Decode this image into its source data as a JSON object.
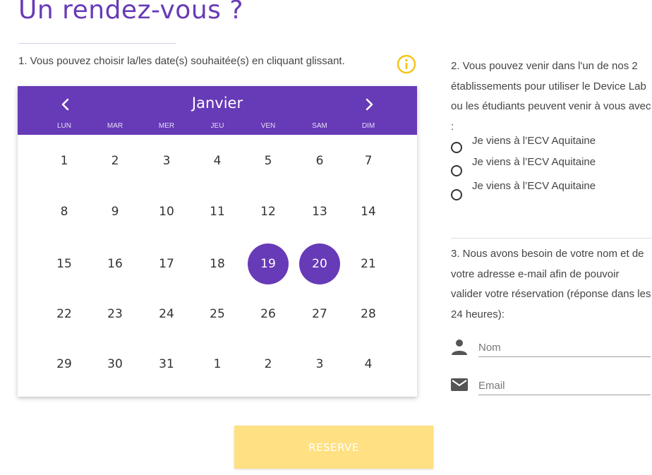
{
  "header": {
    "title": "Un rendez-vous ?",
    "instruction_1": "1. Vous pouvez choisir la/les date(s) souhaitée(s) en cliquant glissant."
  },
  "calendar": {
    "month": "Janvier",
    "weekdays": [
      "LUN",
      "MAR",
      "MER",
      "JEU",
      "VEN",
      "SAM",
      "DIM"
    ],
    "weeks": [
      [
        "1",
        "2",
        "3",
        "4",
        "5",
        "6",
        "7"
      ],
      [
        "8",
        "9",
        "10",
        "11",
        "12",
        "13",
        "14"
      ],
      [
        "15",
        "16",
        "17",
        "18",
        "19",
        "20",
        "21"
      ],
      [
        "22",
        "23",
        "24",
        "25",
        "26",
        "27",
        "28"
      ],
      [
        "29",
        "30",
        "31",
        "1",
        "2",
        "3",
        "4"
      ]
    ],
    "selected_days": [
      "19",
      "20"
    ],
    "accent_color": "#673ab7"
  },
  "location": {
    "instruction_2": "2. Vous pouvez venir dans l'un de nos 2 établissements pour utiliser le Device Lab ou les étudiants peuvent venir à vous avec :",
    "options": [
      "Je viens à l’ECV Aquitaine",
      "Je viens à l’ECV Aquitaine",
      "Je viens à l’ECV Aquitaine"
    ]
  },
  "contact": {
    "instruction_3": "3. Nous avons besoin de votre nom et de votre adresse e-mail afin de pouvoir valider votre réservation (réponse dans les 24 heures):",
    "name_placeholder": "Nom",
    "email_placeholder": "Email",
    "name_icon": "person-icon",
    "email_icon": "mail-icon"
  },
  "actions": {
    "reserve_label": "RESERVE",
    "reserve_color": "#ffe082"
  },
  "info_icon": "info-icon",
  "info_color": "#f5c518"
}
